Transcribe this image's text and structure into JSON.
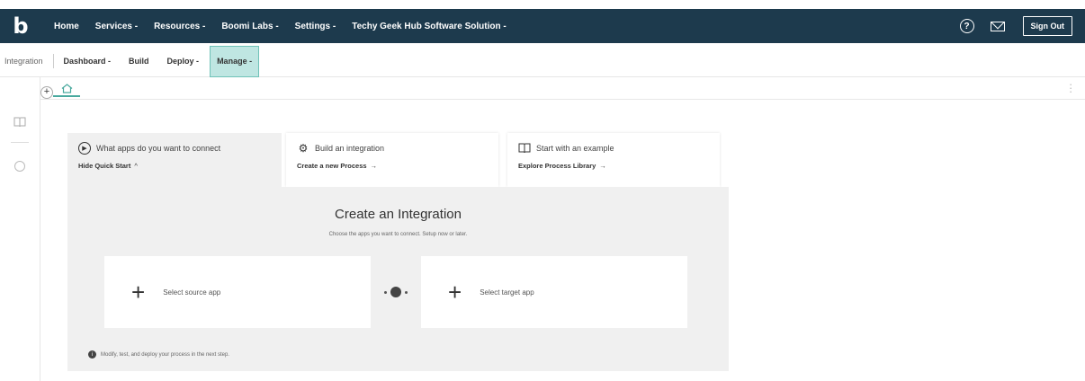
{
  "topbar": {
    "logo": "b",
    "nav": [
      "Home",
      "Services -",
      "Resources -",
      "Boomi Labs -",
      "Settings -",
      "Techy Geek Hub Software Solution -"
    ],
    "help_icon": "?",
    "sign_out": "Sign Out"
  },
  "subnav": {
    "integration": "Integration",
    "dashboard": "Dashboard -",
    "build": "Build",
    "deploy": "Deploy -",
    "manage": "Manage -"
  },
  "quickstart": {
    "card1": {
      "title": "What apps do you want to connect",
      "link": "Hide Quick Start",
      "link_arrow": "^"
    },
    "card2": {
      "title": "Build an integration",
      "link": "Create a new Process",
      "link_arrow": "→"
    },
    "card3": {
      "title": "Start with an example",
      "link": "Explore Process Library",
      "link_arrow": "→"
    }
  },
  "panel": {
    "title": "Create an Integration",
    "subtitle": "Choose the apps you want to connect. Setup now or later.",
    "source_label": "Select source app",
    "target_label": "Select target app",
    "plus": "+",
    "footer": "Modify, test, and deploy your process in the next step."
  },
  "colors": {
    "topbar_bg": "#1d3a4d",
    "active_tab_bg": "#bfe6e2",
    "accent": "#49a99e"
  }
}
